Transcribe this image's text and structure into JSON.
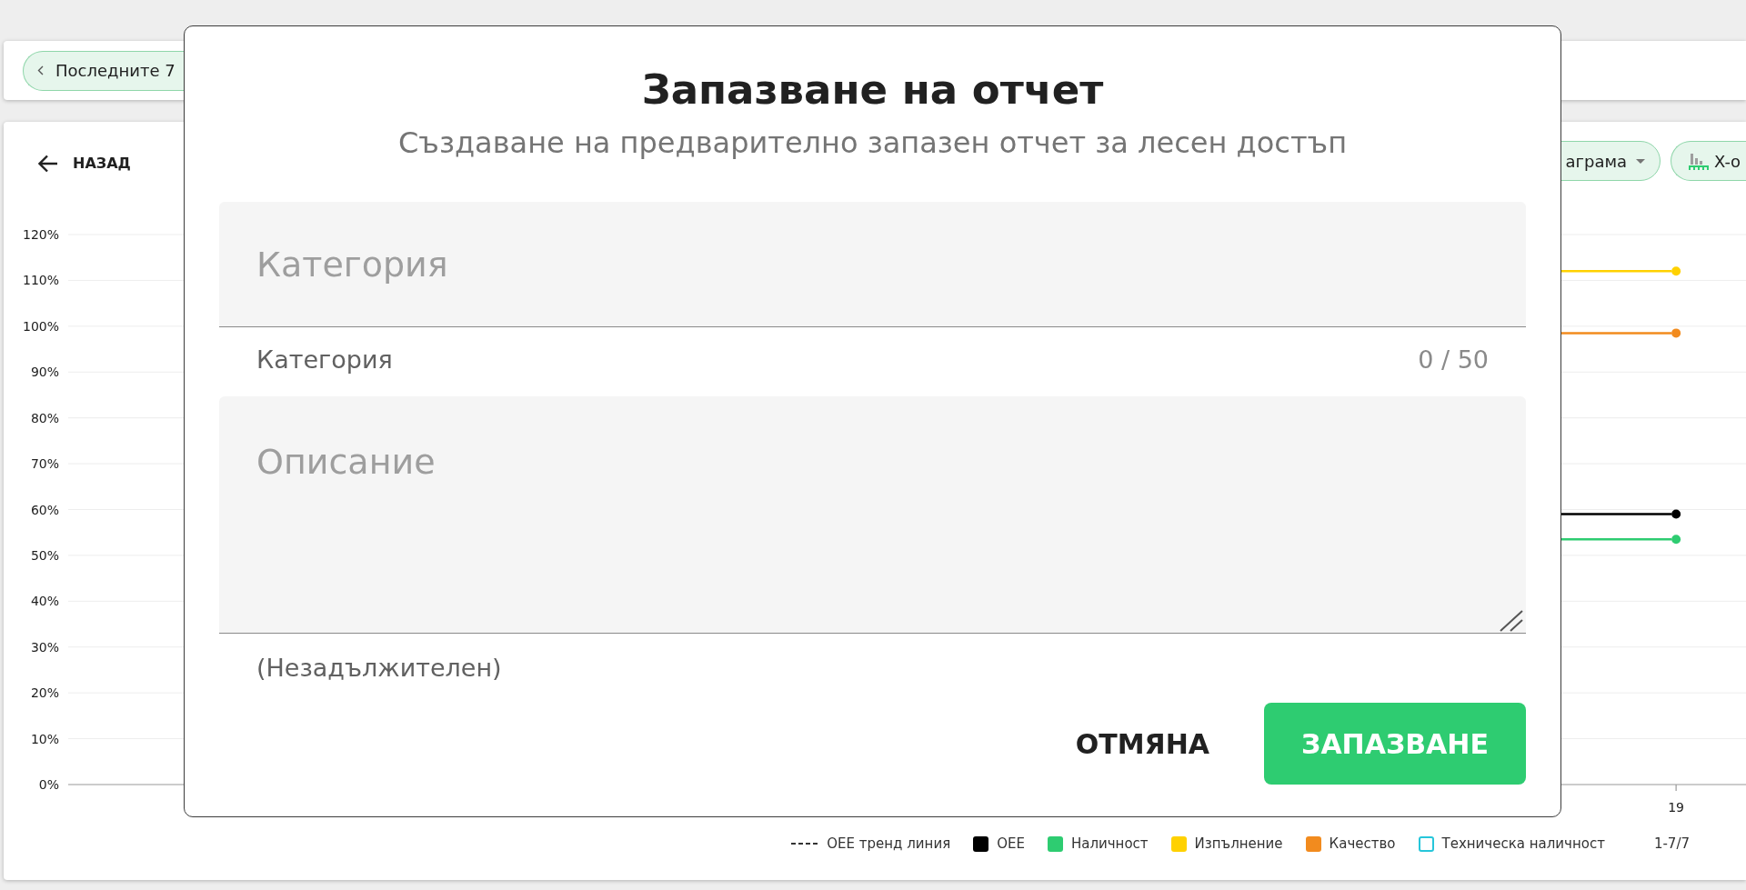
{
  "filter_bar": {
    "date_chip": {
      "label": "Последните 7"
    }
  },
  "chart_card": {
    "back_button": {
      "label": "НАЗАД"
    },
    "chips": [
      {
        "kind": "dropdown",
        "label": "аграма"
      },
      {
        "kind": "axis",
        "label": "X-о"
      }
    ],
    "chart": {
      "chart_data": {
        "type": "line",
        "categories": [
          null,
          null,
          null,
          null,
          null,
          null,
          null,
          null,
          null,
          null,
          null,
          "19"
        ],
        "ylim": [
          0,
          120
        ],
        "yticks": [
          {
            "value": 0,
            "label": "0%"
          },
          {
            "value": 10,
            "label": "10%"
          },
          {
            "value": 20,
            "label": "20%"
          },
          {
            "value": 30,
            "label": "30%"
          },
          {
            "value": 40,
            "label": "40%"
          },
          {
            "value": 50,
            "label": "50%"
          },
          {
            "value": 60,
            "label": "60%"
          },
          {
            "value": 70,
            "label": "70%"
          },
          {
            "value": 80,
            "label": "80%"
          },
          {
            "value": 90,
            "label": "90%"
          },
          {
            "value": 100,
            "label": "100%"
          },
          {
            "value": 110,
            "label": "110%"
          },
          {
            "value": 120,
            "label": "120%"
          }
        ],
        "grid": true,
        "legend": "bottom",
        "series": [
          {
            "name": "OEE тренд линия",
            "color": "#333333",
            "values": [
              null,
              null,
              null,
              null,
              null,
              null,
              null,
              null,
              null,
              null,
              null,
              null
            ]
          },
          {
            "name": "OEE",
            "color": "#000000",
            "marker": "circle",
            "values": [
              null,
              null,
              null,
              null,
              null,
              null,
              null,
              null,
              null,
              null,
              null,
              59
            ]
          },
          {
            "name": "Наличност",
            "color": "#2ecc71",
            "marker": "circle",
            "values": [
              null,
              null,
              null,
              null,
              null,
              null,
              null,
              null,
              null,
              null,
              null,
              53.5
            ]
          },
          {
            "name": "Изпълнение",
            "color": "#ffd100",
            "marker": "circle",
            "values": [
              null,
              null,
              null,
              null,
              null,
              null,
              null,
              null,
              null,
              null,
              null,
              112
            ]
          },
          {
            "name": "Качество",
            "color": "#f28b1e",
            "marker": "circle",
            "values": [
              null,
              null,
              null,
              null,
              null,
              null,
              null,
              null,
              null,
              null,
              null,
              98.5
            ]
          },
          {
            "name": "Техническа наличност",
            "color": "#26c6da",
            "values": [
              null,
              null,
              null,
              null,
              null,
              null,
              null,
              null,
              null,
              null,
              null,
              null
            ]
          }
        ]
      },
      "legend_markers": [
        {
          "kind": "dashed"
        },
        {
          "kind": "filled"
        },
        {
          "kind": "filled"
        },
        {
          "kind": "filled"
        },
        {
          "kind": "filled"
        },
        {
          "kind": "outline"
        }
      ],
      "pager": "1-7/7"
    }
  },
  "dialog": {
    "title": "Запазване на отчет",
    "subtitle": "Създаване на предварително запазен отчет за лесен достъп",
    "fields": [
      {
        "kind": "input",
        "placeholder": "Категория",
        "helper": "Категория",
        "counter": "0 / 50"
      },
      {
        "kind": "textarea",
        "placeholder": "Описание",
        "helper": "(Незадължителен)"
      }
    ],
    "buttons": [
      {
        "kind": "text",
        "label": "ОТМЯНА"
      },
      {
        "kind": "primary",
        "label": "ЗАПАЗВАНЕ"
      }
    ]
  }
}
